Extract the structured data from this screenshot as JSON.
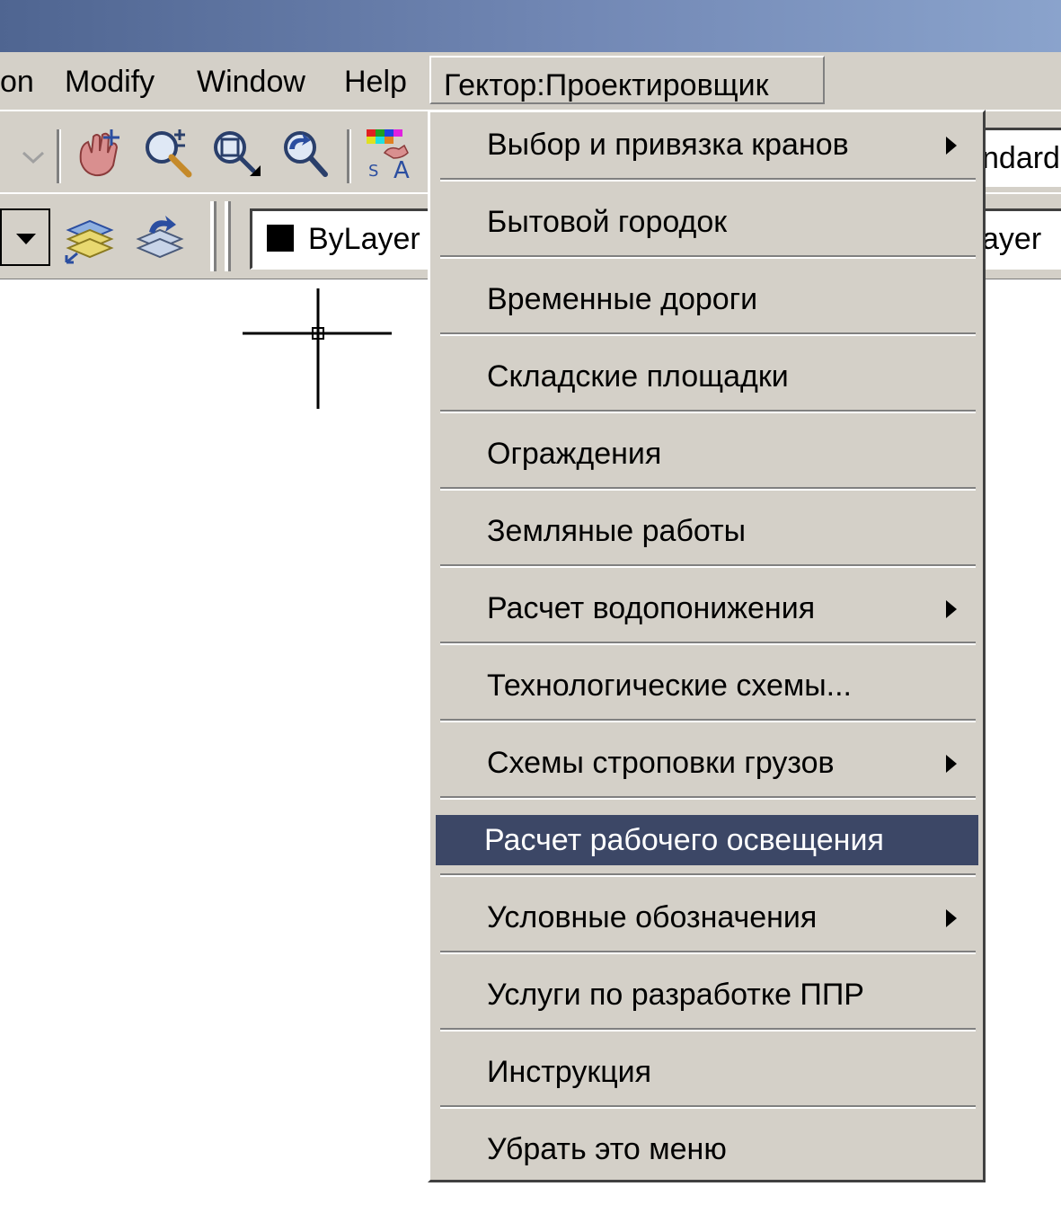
{
  "menubar": {
    "items": [
      "on",
      "Modify",
      "Window",
      "Help"
    ],
    "active": "Гектор:Проектировщик"
  },
  "toolbar": {
    "icons": [
      "pan-realtime-icon",
      "zoom-realtime-icon",
      "zoom-window-icon",
      "zoom-previous-icon",
      "text-style-icon"
    ],
    "style_combo_value": "ndard"
  },
  "properties": {
    "color_combo_value": "ByLayer",
    "linetype_combo_value": "ayer",
    "layer_icons": [
      "layer-manager-icon",
      "layer-previous-icon"
    ]
  },
  "menu": {
    "items": [
      {
        "label": "Выбор и привязка кранов",
        "submenu": true
      },
      {
        "label": "Бытовой городок",
        "submenu": false
      },
      {
        "label": "Временные дороги",
        "submenu": false
      },
      {
        "label": "Складские площадки",
        "submenu": false
      },
      {
        "label": "Ограждения",
        "submenu": false
      },
      {
        "label": "Земляные работы",
        "submenu": false
      },
      {
        "label": "Расчет водопонижения",
        "submenu": true
      },
      {
        "label": "Технологические схемы...",
        "submenu": false
      },
      {
        "label": "Схемы строповки грузов",
        "submenu": true
      },
      {
        "label": "Расчет рабочего освещения",
        "submenu": false,
        "highlighted": true
      },
      {
        "label": "Условные обозначения",
        "submenu": true
      },
      {
        "label": "Услуги по разработке ППР",
        "submenu": false
      },
      {
        "label": "Инструкция",
        "submenu": false
      },
      {
        "label": "Убрать это меню",
        "submenu": false
      }
    ]
  },
  "colors": {
    "title_gradient_start": "#4f6591",
    "title_gradient_end": "#8aa3cc",
    "chrome": "#d4d0c8",
    "highlight": "#3c4766"
  }
}
